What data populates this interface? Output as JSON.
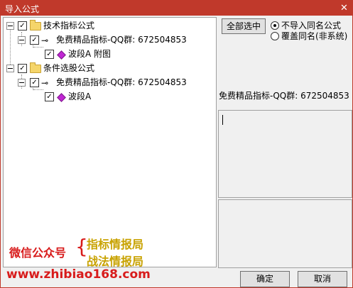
{
  "window": {
    "title": "导入公式",
    "close_glyph": "✕"
  },
  "tree": {
    "nodes": [
      {
        "label": "技术指标公式",
        "checked": true,
        "icon": "folder-icon"
      },
      {
        "label": "免费精品指标-QQ群: 672504853",
        "checked": true,
        "icon": "key-icon"
      },
      {
        "label": "波段A 附图",
        "checked": true,
        "icon": "diamond-icon"
      },
      {
        "label": "条件选股公式",
        "checked": true,
        "icon": "folder-icon"
      },
      {
        "label": "免费精品指标-QQ群: 672504853",
        "checked": true,
        "icon": "key-icon"
      },
      {
        "label": "波段A",
        "checked": true,
        "icon": "diamond-icon"
      }
    ],
    "check_glyph": "✓"
  },
  "options": {
    "select_all_label": "全部选中",
    "radio1_label": "不导入同名公式",
    "radio2_label": "覆盖同名(非系统)",
    "selected": "radio1"
  },
  "info": {
    "label": "免费精品指标-QQ群: 672504853"
  },
  "watermark": {
    "left": "微信公众号",
    "brace": "{",
    "line1": "指标情报局",
    "line2": "战法情报局",
    "url": "www.zhibiao168.com",
    "colors": {
      "red": "#d81b1b",
      "gold": "#c8a200"
    }
  },
  "buttons": {
    "ok_label": "确定",
    "cancel_label": "取消"
  }
}
